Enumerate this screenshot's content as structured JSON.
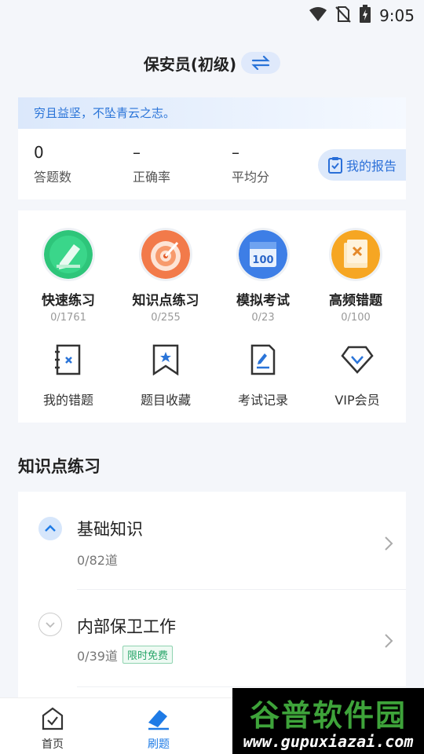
{
  "status_bar": {
    "time": "9:05",
    "icons": [
      "wifi-icon",
      "no-sim-icon",
      "battery-charging-icon"
    ]
  },
  "header": {
    "title": "保安员(初级)",
    "switch_icon": "swap-icon"
  },
  "summary": {
    "quote": "穷且益坚，不坠青云之志。",
    "stats": [
      {
        "value": "0",
        "label": "答题数"
      },
      {
        "value": "–",
        "label": "正确率"
      },
      {
        "value": "–",
        "label": "平均分"
      }
    ],
    "report_button": "我的报告"
  },
  "practice_tiles": [
    {
      "title": "快速练习",
      "count": "0/1761",
      "icon": "pencil-icon",
      "color": "#2ec57a"
    },
    {
      "title": "知识点练习",
      "count": "0/255",
      "icon": "target-icon",
      "color": "#f27a4a"
    },
    {
      "title": "模拟考试",
      "count": "0/23",
      "icon": "calendar-100-icon",
      "color": "#3d7ee6"
    },
    {
      "title": "高频错题",
      "count": "0/100",
      "icon": "wrong-doc-icon",
      "color": "#f6a623"
    }
  ],
  "tools": [
    {
      "label": "我的错题",
      "icon": "wrong-book-icon"
    },
    {
      "label": "题目收藏",
      "icon": "bookmark-icon"
    },
    {
      "label": "考试记录",
      "icon": "exam-record-icon"
    },
    {
      "label": "VIP会员",
      "icon": "diamond-icon"
    }
  ],
  "knowledge_section": {
    "title": "知识点练习",
    "items": [
      {
        "title": "基础知识",
        "count": "0/82道",
        "expanded": true
      },
      {
        "title": "内部保卫工作",
        "count": "0/39道",
        "badge": "限时免费",
        "expanded": false
      }
    ]
  },
  "tab_bar": {
    "tabs": [
      {
        "label": "首页",
        "icon": "home-check-icon",
        "active": false
      },
      {
        "label": "刷题",
        "icon": "eraser-pen-icon",
        "active": true
      }
    ]
  },
  "watermark": {
    "title": "谷普软件园",
    "url": "www.gupuxiazai.com"
  },
  "colors": {
    "accent": "#1e7be6",
    "badge_green": "#2aa66a"
  }
}
